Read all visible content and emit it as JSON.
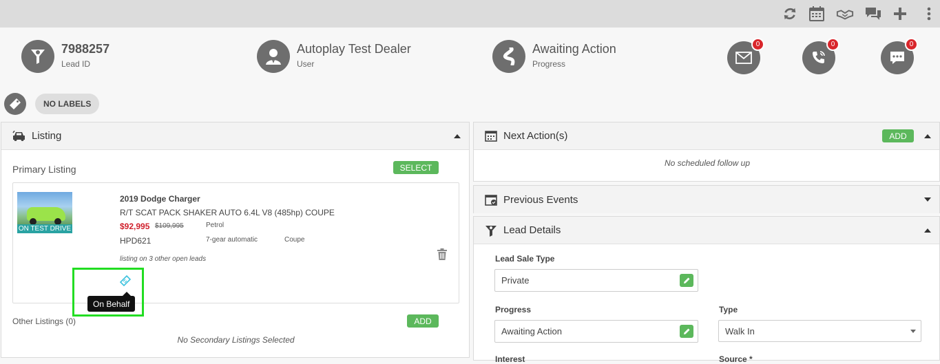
{
  "topbar": {
    "icons": [
      "refresh-icon",
      "calendar-icon",
      "handshake-icon",
      "chat-icon",
      "plus-icon",
      "more-vertical-icon"
    ]
  },
  "header": {
    "lead": {
      "value": "7988257",
      "label": "Lead ID"
    },
    "user": {
      "value": "Autoplay Test Dealer",
      "label": "User"
    },
    "progress": {
      "value": "Awaiting Action",
      "label": "Progress"
    },
    "email_count": "0",
    "call_count": "0",
    "sms_count": "0"
  },
  "labels": {
    "none_text": "NO LABELS"
  },
  "listing_panel": {
    "title": "Listing",
    "primary_title": "Primary Listing",
    "select_label": "SELECT",
    "vehicle": {
      "photo_badge": "ON TEST DRIVE",
      "title": "2019 Dodge Charger",
      "variant": "R/T SCAT PACK SHAKER AUTO 6.4L V8 (485hp) COUPE",
      "price": "$92,995",
      "old_price": "$109,995",
      "fuel": "Petrol",
      "rego": "HPD621",
      "transmission": "7-gear automatic",
      "body": "Coupe",
      "open_leads_note": "listing on 3 other open leads"
    },
    "tooltip": "On Behalf",
    "other_title": "Other Listings (0)",
    "add_label": "ADD",
    "no_secondary": "No Secondary Listings Selected"
  },
  "next_actions": {
    "title": "Next Action(s)",
    "add_label": "ADD",
    "empty_text": "No scheduled follow up"
  },
  "previous_events": {
    "title": "Previous Events"
  },
  "lead_details": {
    "title": "Lead Details",
    "sale_type_label": "Lead Sale Type",
    "sale_type_value": "Private",
    "progress_label": "Progress",
    "progress_value": "Awaiting Action",
    "type_label": "Type",
    "type_value": "Walk In",
    "interest_label": "Interest",
    "source_label": "Source *"
  },
  "colors": {
    "accent_green": "#5cb85c",
    "badge_red": "#d9262b",
    "price_red": "#d0202c",
    "highlight_green": "#22dd22",
    "photo_banner_teal": "#2aa3a3"
  }
}
